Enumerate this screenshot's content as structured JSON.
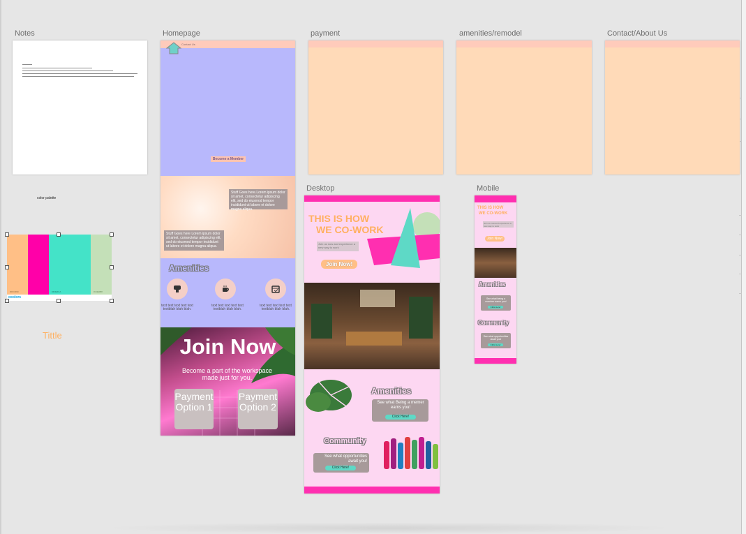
{
  "artboards": {
    "notes": {
      "label": "Notes"
    },
    "homepage": {
      "label": "Homepage"
    },
    "payment": {
      "label": "payment"
    },
    "amenities": {
      "label": "amenities/remodel"
    },
    "contact": {
      "label": "Contact/About Us"
    },
    "desktop": {
      "label": "Desktop"
    },
    "mobile": {
      "label": "Mobile"
    }
  },
  "palette": {
    "label": "color palette",
    "colors": [
      "#ffbf86",
      "#ff00a8",
      "#44e3c8",
      "#c4e0b8"
    ],
    "codes": [
      "#FFC690",
      "",
      "#4DE6CA",
      "#C4E0B8"
    ],
    "brand": "coolors",
    "title_sample": "Tittle",
    "accent": "#ffb060"
  },
  "homepage": {
    "nav_text": "Contact Us",
    "hero_button": "Become a Member",
    "stuff_text_1": "Stuff Goes here.Lorem ipsum dolor sit amet, consectetur adipiscing elit, sed do eiusmod tempor incididunt ut labore et dolore magna aliqua.",
    "stuff_text_2": "Stuff Goes here Lorem ipsum dolor sit amet, consectetur adipiscing elit, sed do eiusmod tempor incididunt ut labore et dolore magna aliqua.",
    "amenities_title": "Amenities",
    "amenity_items": [
      {
        "icon": "coffee-maker-icon",
        "text": "text text text text text textblah blah blah."
      },
      {
        "icon": "coffee-cup-icon",
        "text": "text text text text text textblah blah blah."
      },
      {
        "icon": "calendar-icon",
        "text": "text text text text text textblah blah blah."
      }
    ],
    "join_title": "Join Now",
    "join_sub": "Become a part of the workspace made just for you.",
    "payment_1": "Payment Option 1",
    "payment_2": "Payment Option 2"
  },
  "desktop": {
    "headline_1": "THIS IS HOW",
    "headline_2": "WE CO-WORK",
    "sub_text": "Join us now and experience a new way to work",
    "join_button": "Join Now!",
    "amenities_title": "Amenities",
    "amenities_text": "See what Being a memer earns you!",
    "amenities_button": "Click Here!",
    "community_title": "Community",
    "community_text": "See what opportunities await you!",
    "community_button": "Click Here!"
  },
  "mobile": {
    "headline_1": "THIS IS HOW",
    "headline_2": "WE CO-WORK",
    "sub_text": "Join us now and experience a new way to work",
    "join_button": "Join Now!",
    "amenities_title": "Amenities",
    "amenities_text": "See what being a member earns you!",
    "amenities_button": "Click Here!",
    "community_title": "Community",
    "community_text": "See what opportunities await you!",
    "community_button": "Click Here!"
  }
}
